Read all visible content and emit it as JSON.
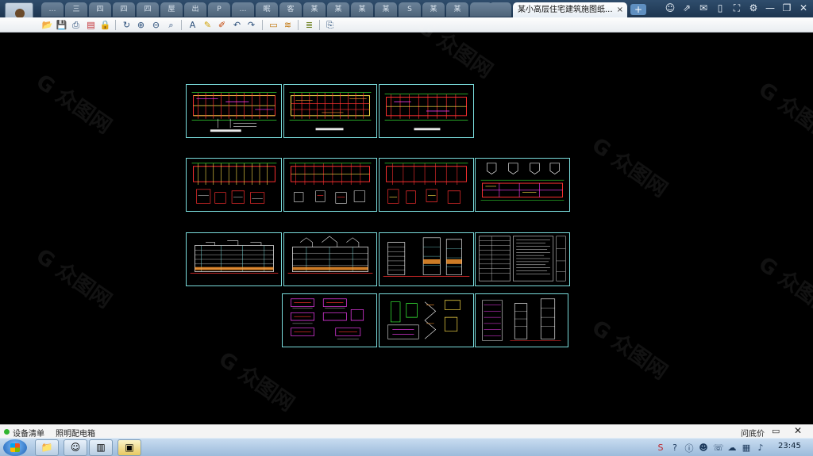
{
  "tabs": {
    "inactive": [
      "…",
      "三",
      "四",
      "四",
      "四",
      "屋",
      "出",
      "P",
      "…",
      "眠",
      "客",
      "某",
      "某",
      "某",
      "某",
      "S",
      "某",
      "某"
    ],
    "active_label": "某小高层住宅建筑施图纸...",
    "close_glyph": "×",
    "new_tab_glyph": "+"
  },
  "window_controls": [
    "user-icon",
    "share-icon",
    "chat-icon",
    "phone-icon",
    "fullscreen-icon",
    "settings-icon",
    "minimize-icon",
    "restore-icon",
    "close-icon"
  ],
  "toolbar": {
    "buttons": [
      "open-icon",
      "save-icon",
      "print-icon",
      "pdf-icon",
      "lock-icon",
      "rotate-icon",
      "zoom-in-icon",
      "zoom-out-icon",
      "zoom-window-icon",
      "text-icon",
      "pencil-icon",
      "markup-icon",
      "undo-icon",
      "redo-icon",
      "measure-icon",
      "dimension-icon",
      "layers-icon",
      "export-icon"
    ]
  },
  "status_bar": {
    "item1": "设备清单",
    "item2": "照明配电箱",
    "ask_label": "问底价",
    "comment_glyph": "💬",
    "close_glyph": "✕"
  },
  "watermark_text": "G 众图网",
  "taskbar": {
    "apps": [
      "explorer-icon",
      "avatar-app-icon",
      "books-icon",
      "cad-viewer-icon"
    ],
    "tray": [
      "s-icon",
      "help-icon",
      "ime-icon",
      "penguin-icon",
      "chat-icon",
      "cloud-icon",
      "network-icon",
      "volume-icon"
    ],
    "clock": "23:45"
  },
  "colors": {
    "sheet_border": "#7adcdc",
    "red": "#ff3030",
    "yellow": "#ffe14a",
    "green": "#3cff3c",
    "magenta": "#ff40ff",
    "white": "#e8e8e8",
    "orange": "#ff9a30"
  }
}
